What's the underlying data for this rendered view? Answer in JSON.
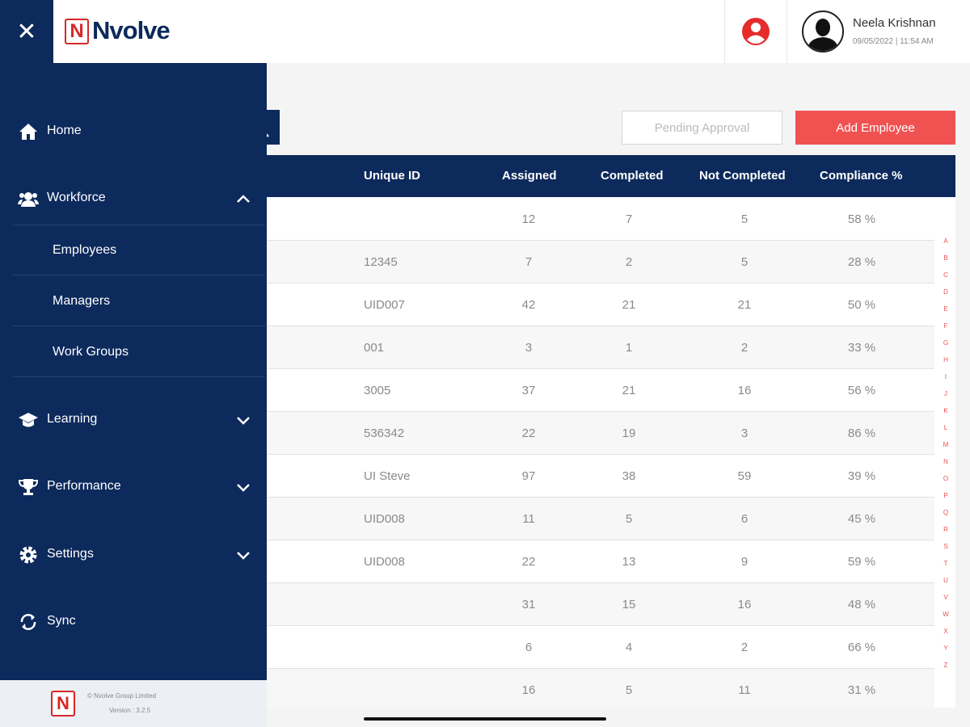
{
  "header": {
    "user_name": "Neela Krishnan",
    "user_datetime": "09/05/2022 | 11:54 AM"
  },
  "toolbar": {
    "pending_label": "Pending Approval",
    "add_label": "Add Employee"
  },
  "table": {
    "columns": [
      "Unique ID",
      "Assigned",
      "Completed",
      "Not Completed",
      "Compliance %"
    ],
    "rows": [
      {
        "uid": "",
        "assigned": "12",
        "completed": "7",
        "not_completed": "5",
        "compliance": "58 %"
      },
      {
        "uid": "12345",
        "assigned": "7",
        "completed": "2",
        "not_completed": "5",
        "compliance": "28 %"
      },
      {
        "uid": "UID007",
        "assigned": "42",
        "completed": "21",
        "not_completed": "21",
        "compliance": "50 %"
      },
      {
        "uid": "001",
        "assigned": "3",
        "completed": "1",
        "not_completed": "2",
        "compliance": "33 %"
      },
      {
        "uid": "3005",
        "assigned": "37",
        "completed": "21",
        "not_completed": "16",
        "compliance": "56 %"
      },
      {
        "uid": "536342",
        "assigned": "22",
        "completed": "19",
        "not_completed": "3",
        "compliance": "86 %"
      },
      {
        "uid": "UI Steve",
        "assigned": "97",
        "completed": "38",
        "not_completed": "59",
        "compliance": "39 %"
      },
      {
        "uid": "UID008",
        "assigned": "11",
        "completed": "5",
        "not_completed": "6",
        "compliance": "45 %"
      },
      {
        "uid": "UID008",
        "assigned": "22",
        "completed": "13",
        "not_completed": "9",
        "compliance": "59 %"
      },
      {
        "uid": "",
        "assigned": "31",
        "completed": "15",
        "not_completed": "16",
        "compliance": "48 %"
      },
      {
        "uid": "",
        "assigned": "6",
        "completed": "4",
        "not_completed": "2",
        "compliance": "66 %"
      },
      {
        "uid": "",
        "assigned": "16",
        "completed": "5",
        "not_completed": "11",
        "compliance": "31 %"
      }
    ]
  },
  "alphabet": [
    "A",
    "B",
    "C",
    "D",
    "E",
    "F",
    "G",
    "H",
    "I",
    "J",
    "K",
    "L",
    "M",
    "N",
    "O",
    "P",
    "Q",
    "R",
    "S",
    "T",
    "U",
    "V",
    "W",
    "X",
    "Y",
    "Z"
  ],
  "sidebar": {
    "close_icon": "close-icon",
    "brand_letter": "N",
    "brand_name": "Nvolve",
    "items": {
      "home": "Home",
      "workforce": "Workforce",
      "employees": "Employees",
      "managers": "Managers",
      "work_groups": "Work Groups",
      "learning": "Learning",
      "performance": "Performance",
      "settings": "Settings",
      "sync": "Sync"
    },
    "footer": {
      "copyright": "© Nvolve Group Limited",
      "version": "Version : 3.2.5"
    }
  },
  "colors": {
    "navy": "#0d2a5c",
    "accent_red": "#f05252"
  }
}
